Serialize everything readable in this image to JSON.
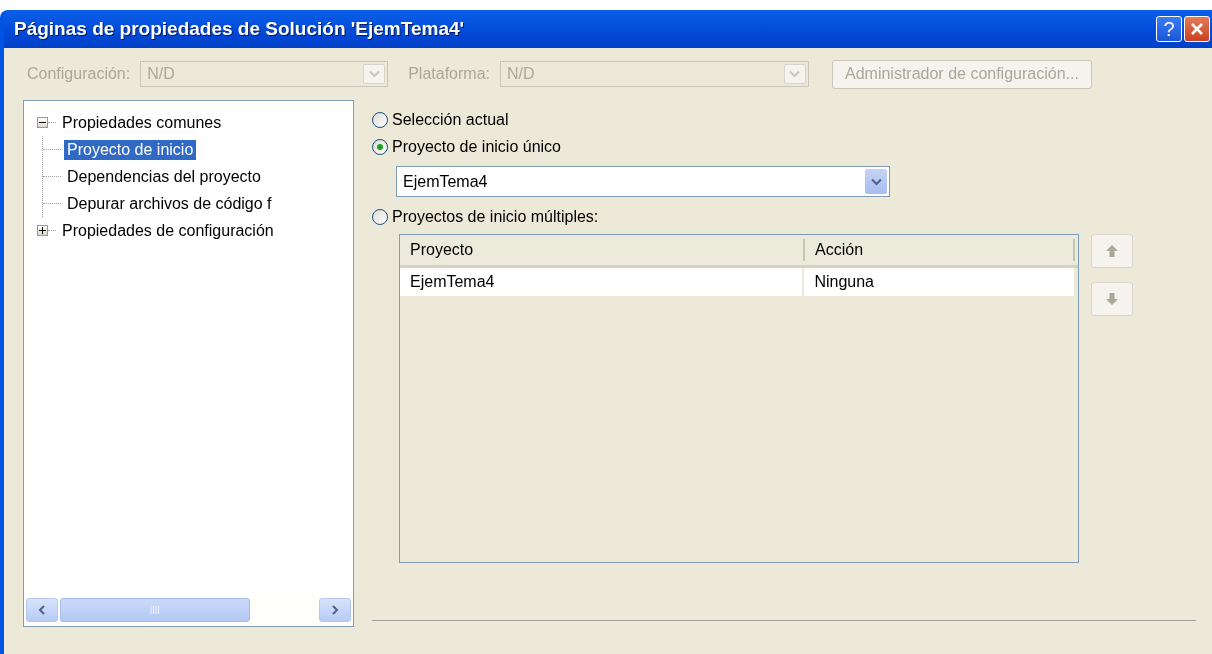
{
  "window": {
    "title": "Páginas de propiedades de Solución 'EjemTema4'",
    "help_label": "?"
  },
  "toolbar": {
    "configuration": {
      "label": "Configuración:",
      "value": "N/D",
      "disabled": true
    },
    "platform": {
      "label": "Plataforma:",
      "value": "N/D",
      "disabled": true
    },
    "manager_button": {
      "label": "Administrador de configuración...",
      "disabled": true
    }
  },
  "tree": [
    {
      "label": "Propiedades comunes",
      "expanded": true,
      "selected": false,
      "children": [
        {
          "label": "Proyecto de inicio",
          "selected": true
        },
        {
          "label": "Dependencias del proyecto",
          "selected": false
        },
        {
          "label": "Depurar archivos de código f",
          "selected": false
        }
      ]
    },
    {
      "label": "Propiedades de configuración",
      "expanded": false,
      "selected": false
    }
  ],
  "options": [
    {
      "label": "Selección actual",
      "selected": false
    },
    {
      "label": "Proyecto de inicio único",
      "selected": true
    },
    {
      "label": "Proyectos de inicio múltiples:",
      "selected": false
    }
  ],
  "single_project": {
    "value": "EjemTema4"
  },
  "table": {
    "columns": [
      "Proyecto",
      "Acción"
    ],
    "rows": [
      [
        "EjemTema4",
        "Ninguna"
      ]
    ]
  },
  "move_buttons": [
    {
      "kind": "up",
      "disabled": true
    },
    {
      "kind": "down",
      "disabled": true
    }
  ]
}
